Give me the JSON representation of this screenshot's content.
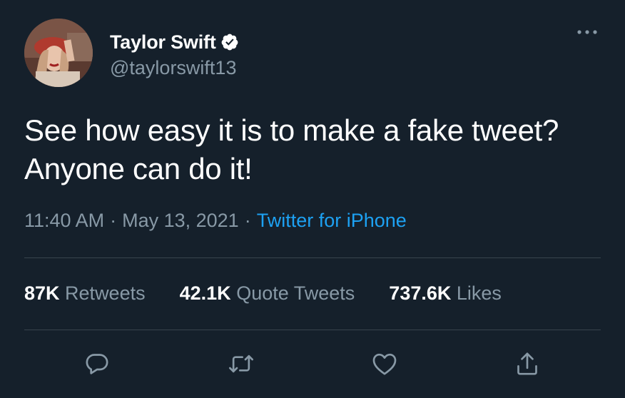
{
  "user": {
    "display_name": "Taylor Swift",
    "handle": "@taylorswift13",
    "verified": true,
    "avatar_icon": "profile-photo"
  },
  "tweet": {
    "text": "See how easy it is to make a fake tweet? Anyone can do it!",
    "time": "11:40 AM",
    "separator": "·",
    "date": "May 13, 2021",
    "source": "Twitter for iPhone"
  },
  "stats": {
    "retweets_count": "87K",
    "retweets_label": "Retweets",
    "quotes_count": "42.1K",
    "quotes_label": "Quote Tweets",
    "likes_count": "737.6K",
    "likes_label": "Likes"
  },
  "actions": {
    "reply_icon": "reply-icon",
    "retweet_icon": "retweet-icon",
    "like_icon": "heart-icon",
    "share_icon": "share-icon",
    "more_icon": "more-dots-icon"
  },
  "colors": {
    "background": "#15202b",
    "primary_text": "#ffffff",
    "secondary_text": "#8899a6",
    "accent": "#1da1f2",
    "divider": "#38444d"
  }
}
